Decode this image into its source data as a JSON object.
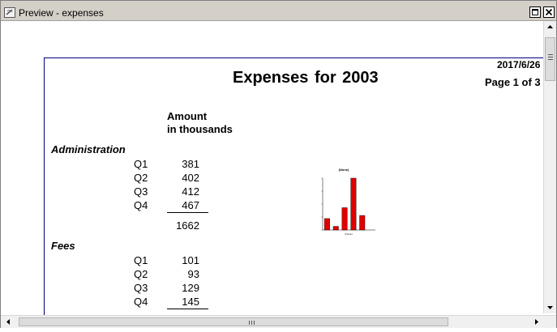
{
  "window": {
    "title": "Preview - expenses"
  },
  "report": {
    "date": "2017/6/26",
    "page_label": "Page 1 of 3",
    "title": "Expenses for  2003",
    "column_header_line1": "Amount",
    "column_header_line2": "in thousands",
    "sections": [
      {
        "name": "Administration",
        "rows": [
          {
            "quarter": "Q1",
            "amount": "381"
          },
          {
            "quarter": "Q2",
            "amount": "402"
          },
          {
            "quarter": "Q3",
            "amount": "412"
          },
          {
            "quarter": "Q4",
            "amount": "467"
          }
        ],
        "total": "1662"
      },
      {
        "name": "Fees",
        "rows": [
          {
            "quarter": "Q1",
            "amount": "101"
          },
          {
            "quarter": "Q2",
            "amount": "93"
          },
          {
            "quarter": "Q3",
            "amount": "129"
          },
          {
            "quarter": "Q4",
            "amount": "145"
          }
        ]
      }
    ]
  },
  "chart_data": {
    "type": "bar",
    "title": "(None)",
    "xlabel": "(None)",
    "ylabel": "",
    "categories": [
      "",
      "",
      "",
      "",
      "",
      ""
    ],
    "values": [
      0.22,
      0.07,
      0.43,
      1.0,
      0.28,
      0
    ],
    "bar_color": "#e00000"
  },
  "icons": {
    "app": "preview-document-icon",
    "restore": "restore-icon",
    "close": "close-icon",
    "scroll_up": "scroll-up-arrow-icon",
    "scroll_down": "scroll-down-arrow-icon",
    "scroll_left": "scroll-left-arrow-icon",
    "scroll_right": "scroll-right-arrow-icon"
  },
  "scroll": {
    "vertical_position": 0.0,
    "horizontal_position": 0.0
  }
}
